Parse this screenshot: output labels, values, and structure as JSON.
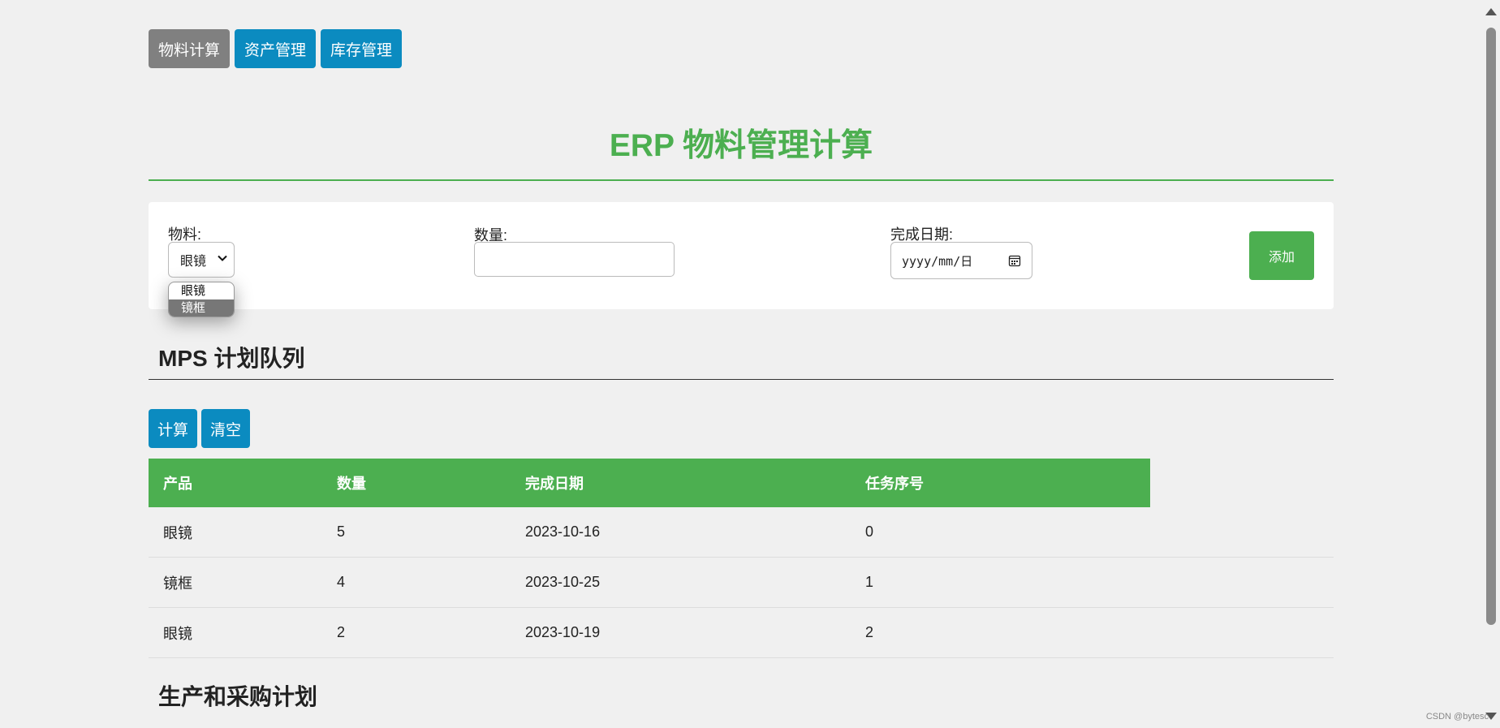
{
  "nav": {
    "items": [
      {
        "label": "物料计算",
        "active": true
      },
      {
        "label": "资产管理",
        "active": false
      },
      {
        "label": "库存管理",
        "active": false
      }
    ]
  },
  "title": "ERP 物料管理计算",
  "form": {
    "material_label": "物料:",
    "material_value": "眼镜",
    "material_options": [
      "眼镜",
      "镜框"
    ],
    "material_highlighted": "镜框",
    "quantity_label": "数量:",
    "quantity_value": "",
    "date_label": "完成日期:",
    "date_placeholder": "yyyy/mm/日",
    "add_label": "添加"
  },
  "mps": {
    "heading": "MPS 计划队列",
    "calc_label": "计算",
    "clear_label": "清空",
    "columns": [
      "产品",
      "数量",
      "完成日期",
      "任务序号"
    ],
    "rows": [
      [
        "眼镜",
        "5",
        "2023-10-16",
        "0"
      ],
      [
        "镜框",
        "4",
        "2023-10-25",
        "1"
      ],
      [
        "眼镜",
        "2",
        "2023-10-19",
        "2"
      ]
    ]
  },
  "plan": {
    "heading": "生产和采购计划"
  },
  "watermark": "CSDN @bytesc",
  "colors": {
    "accent_green": "#4caf50",
    "button_blue": "#0b8bc0",
    "active_gray": "#808080"
  }
}
